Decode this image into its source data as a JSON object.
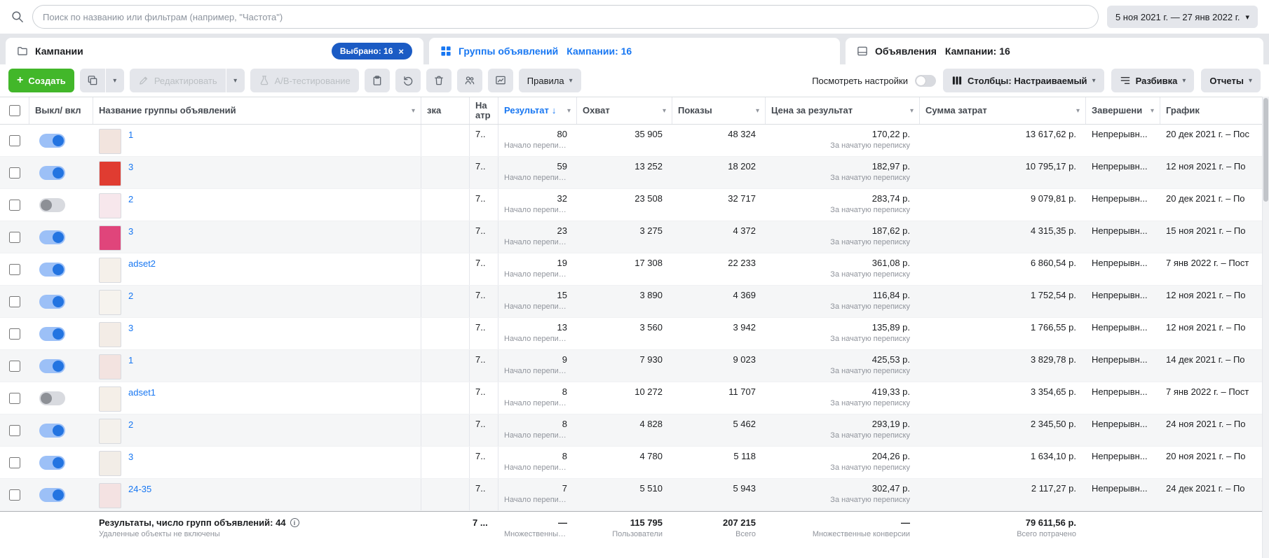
{
  "icons": {
    "chevron_down": "▾",
    "sort_down": "↓",
    "close": "×",
    "plus": "+",
    "info": "i"
  },
  "topbar": {
    "search_placeholder": "Поиск по названию или фильтрам (например, \"Частота\")",
    "date_range": "5 ноя 2021 г. — 27 янв 2022 г."
  },
  "tabs": {
    "campaigns": {
      "label": "Кампании",
      "badge": "Выбрано: 16"
    },
    "adsets": {
      "label": "Группы объявлений",
      "suffix": "Кампании: 16"
    },
    "ads": {
      "label": "Объявления",
      "suffix": "Кампании: 16"
    }
  },
  "toolbar": {
    "create": "Создать",
    "edit": "Редактировать",
    "ab_test": "A/B-тестирование",
    "rules": "Правила",
    "view_settings": "Посмотреть настройки",
    "columns": "Столбцы: Настраиваемый",
    "breakdown": "Разбивка",
    "reports": "Отчеты"
  },
  "table": {
    "headers": {
      "toggle": "Выкл/ вкл",
      "name": "Название группы объявлений",
      "delivery": "зка",
      "attribution": "На атр",
      "result": "Результат",
      "reach": "Охват",
      "impressions": "Показы",
      "cost_per_result": "Цена за результат",
      "amount_spent": "Сумма затрат",
      "ends": "Завершени",
      "schedule": "График"
    },
    "rows": [
      {
        "name": "1",
        "on": true,
        "thumb": "#f2e4de",
        "attribution": "7..",
        "result": "80",
        "result_sub": "Начало переписк...",
        "reach": "35 905",
        "impressions": "48 324",
        "cost_per_result": "170,22 р.",
        "cost_per_result_sub": "За начатую переписку",
        "amount_spent": "13 617,62 р.",
        "ends": "Непрерывн...",
        "schedule": "20 дек 2021 г. – Пос"
      },
      {
        "name": "3",
        "on": true,
        "thumb": "#e03c31",
        "attribution": "7..",
        "result": "59",
        "result_sub": "Начало переписк...",
        "reach": "13 252",
        "impressions": "18 202",
        "cost_per_result": "182,97 р.",
        "cost_per_result_sub": "За начатую переписку",
        "amount_spent": "10 795,17 р.",
        "ends": "Непрерывн...",
        "schedule": "12 ноя 2021 г. – По"
      },
      {
        "name": "2",
        "on": false,
        "thumb": "#f7e7ec",
        "attribution": "7..",
        "result": "32",
        "result_sub": "Начало переписк...",
        "reach": "23 508",
        "impressions": "32 717",
        "cost_per_result": "283,74 р.",
        "cost_per_result_sub": "За начатую переписку",
        "amount_spent": "9 079,81 р.",
        "ends": "Непрерывн...",
        "schedule": "20 дек 2021 г. – По"
      },
      {
        "name": "3",
        "on": true,
        "thumb": "#e0457b",
        "attribution": "7..",
        "result": "23",
        "result_sub": "Начало переписк...",
        "reach": "3 275",
        "impressions": "4 372",
        "cost_per_result": "187,62 р.",
        "cost_per_result_sub": "За начатую переписку",
        "amount_spent": "4 315,35 р.",
        "ends": "Непрерывн...",
        "schedule": "15 ноя 2021 г. – По"
      },
      {
        "name": "adset2",
        "on": true,
        "thumb": "#f5f0ea",
        "attribution": "7..",
        "result": "19",
        "result_sub": "Начало переписк...",
        "reach": "17 308",
        "impressions": "22 233",
        "cost_per_result": "361,08 р.",
        "cost_per_result_sub": "За начатую переписку",
        "amount_spent": "6 860,54 р.",
        "ends": "Непрерывн...",
        "schedule": "7 янв 2022 г. – Пост"
      },
      {
        "name": "2",
        "on": true,
        "thumb": "#f6f3ee",
        "attribution": "7..",
        "result": "15",
        "result_sub": "Начало переписк...",
        "reach": "3 890",
        "impressions": "4 369",
        "cost_per_result": "116,84 р.",
        "cost_per_result_sub": "За начатую переписку",
        "amount_spent": "1 752,54 р.",
        "ends": "Непрерывн...",
        "schedule": "12 ноя 2021 г. – По"
      },
      {
        "name": "3",
        "on": true,
        "thumb": "#f3ece6",
        "attribution": "7..",
        "result": "13",
        "result_sub": "Начало переписк...",
        "reach": "3 560",
        "impressions": "3 942",
        "cost_per_result": "135,89 р.",
        "cost_per_result_sub": "За начатую переписку",
        "amount_spent": "1 766,55 р.",
        "ends": "Непрерывн...",
        "schedule": "12 ноя 2021 г. – По"
      },
      {
        "name": "1",
        "on": true,
        "thumb": "#f3e3e0",
        "attribution": "7..",
        "result": "9",
        "result_sub": "Начало переписк...",
        "reach": "7 930",
        "impressions": "9 023",
        "cost_per_result": "425,53 р.",
        "cost_per_result_sub": "За начатую переписку",
        "amount_spent": "3 829,78 р.",
        "ends": "Непрерывн...",
        "schedule": "14 дек 2021 г. – По"
      },
      {
        "name": "adset1",
        "on": false,
        "thumb": "#f5efe8",
        "attribution": "7..",
        "result": "8",
        "result_sub": "Начало переписк...",
        "reach": "10 272",
        "impressions": "11 707",
        "cost_per_result": "419,33 р.",
        "cost_per_result_sub": "За начатую переписку",
        "amount_spent": "3 354,65 р.",
        "ends": "Непрерывн...",
        "schedule": "7 янв 2022 г. – Пост"
      },
      {
        "name": "2",
        "on": true,
        "thumb": "#f4f1ec",
        "attribution": "7..",
        "result": "8",
        "result_sub": "Начало переписк...",
        "reach": "4 828",
        "impressions": "5 462",
        "cost_per_result": "293,19 р.",
        "cost_per_result_sub": "За начатую переписку",
        "amount_spent": "2 345,50 р.",
        "ends": "Непрерывн...",
        "schedule": "24 ноя 2021 г. – По"
      },
      {
        "name": "3",
        "on": true,
        "thumb": "#f2ede7",
        "attribution": "7..",
        "result": "8",
        "result_sub": "Начало переписк...",
        "reach": "4 780",
        "impressions": "5 118",
        "cost_per_result": "204,26 р.",
        "cost_per_result_sub": "За начатую переписку",
        "amount_spent": "1 634,10 р.",
        "ends": "Непрерывн...",
        "schedule": "20 ноя 2021 г. – По"
      },
      {
        "name": "24-35",
        "on": true,
        "thumb": "#f4e2e2",
        "attribution": "7..",
        "result": "7",
        "result_sub": "Начало переписк...",
        "reach": "5 510",
        "impressions": "5 943",
        "cost_per_result": "302,47 р.",
        "cost_per_result_sub": "За начатую переписку",
        "amount_spent": "2 117,27 р.",
        "ends": "Непрерывн...",
        "schedule": "24 дек 2021 г. – По"
      }
    ]
  },
  "footer": {
    "summary": "Результаты, число групп объявлений: 44",
    "note": "Удаленные объекты не включены",
    "attribution": "7 ...",
    "result": "—",
    "result_sub": "Множественные к...",
    "reach": "115 795",
    "reach_sub": "Пользователи",
    "impressions": "207 215",
    "impressions_sub": "Всего",
    "cost_per_result": "—",
    "cost_per_result_sub": "Множественные конверсии",
    "amount_spent": "79 611,56 р.",
    "amount_spent_sub": "Всего потрачено"
  }
}
